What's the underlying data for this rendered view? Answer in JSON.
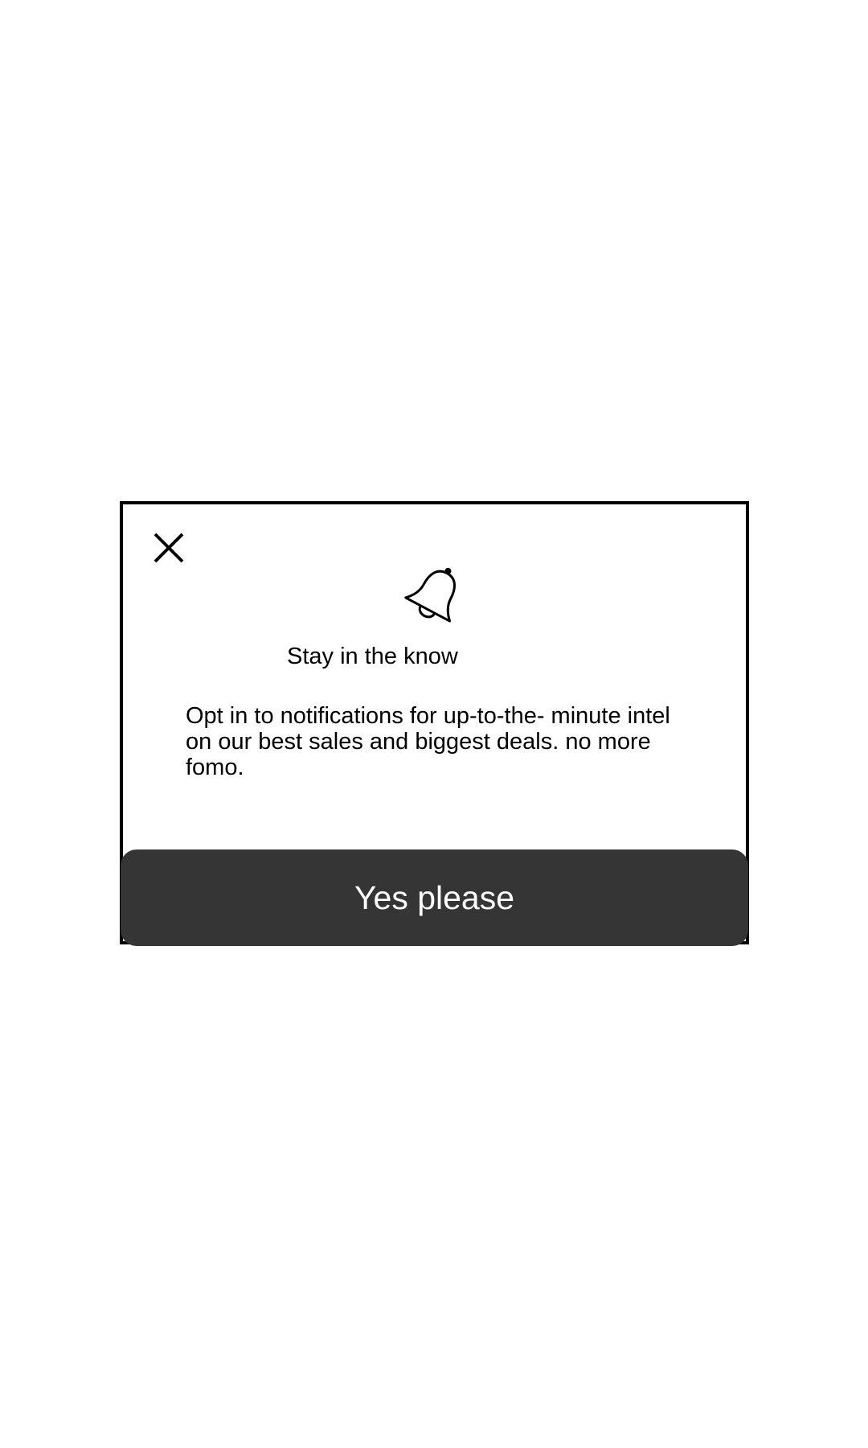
{
  "dialog": {
    "close_icon": "close-icon",
    "bell_icon": "bell-icon",
    "title": "Stay in the know",
    "body": "Opt in to notifications for up-to-the- minute intel on our best sales and biggest deals. no more fomo.",
    "cta_label": "Yes please"
  },
  "colors": {
    "cta_background": "#353535",
    "cta_text": "#ffffff",
    "border": "#000000"
  }
}
